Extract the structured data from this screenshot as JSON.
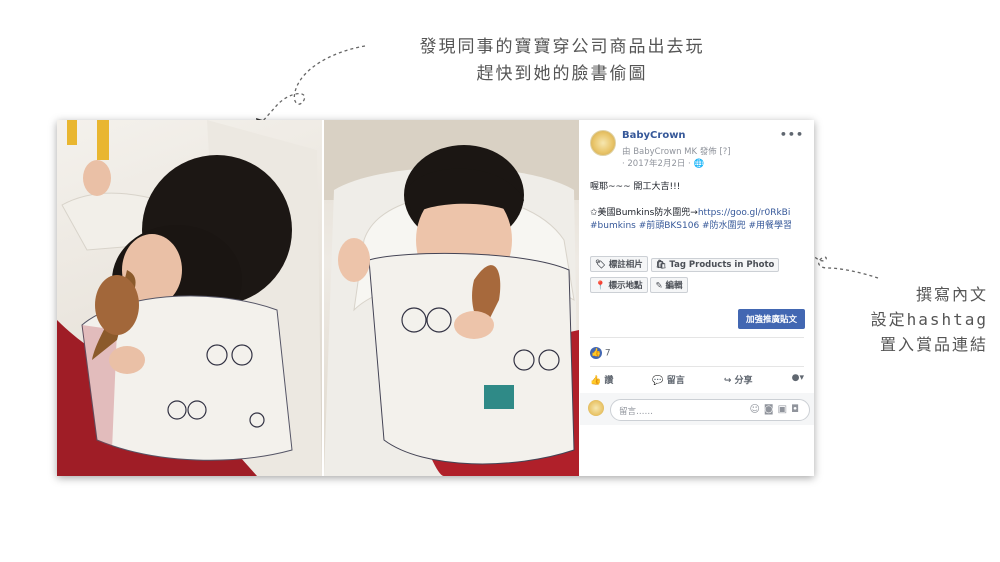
{
  "annotations": {
    "top_line1": "發現同事的寶寶穿公司商品出去玩",
    "top_line2": "趕快到她的臉書偷圖",
    "right_line1": "撰寫內文",
    "right_line2": "設定hashtag",
    "right_line3": "置入賞品連結"
  },
  "post": {
    "page_name": "BabyCrown",
    "posted_by": "由 BabyCrown MK 發佈 [?]",
    "date": "· 2017年2月2日 · 🌐",
    "more": "•••",
    "text_line1": "喔耶~~~ 開工大吉!!!",
    "text_line2_prefix": "✩美國Bumkins防水圍兜→",
    "link": "https://goo.gl/r0RkBi",
    "hashtags": "#bumkins #前頭BKS106 #防水圍兜 #用餐學習",
    "tag_photo": "標註相片",
    "tag_products": "Tag Products in Photo",
    "check_in": "標示地點",
    "edit": "編輯",
    "boost": "加強推廣貼文",
    "reaction_count": "7",
    "like": "讚",
    "comment": "留言",
    "share": "分享",
    "comment_placeholder": "留言……"
  },
  "colors": {
    "accent": "#4267b2",
    "link": "#365899",
    "bib_red": "#b0202a"
  }
}
